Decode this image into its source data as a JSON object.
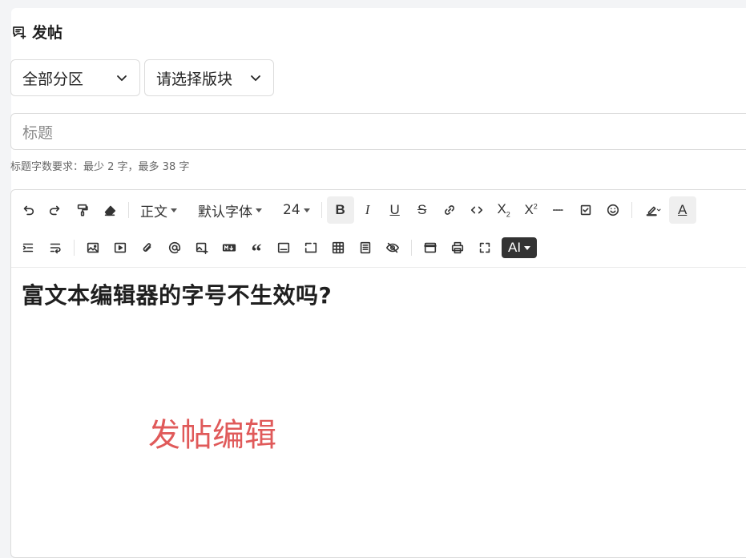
{
  "page": {
    "title": "发帖"
  },
  "selectors": {
    "category": "全部分区",
    "board": "请选择版块"
  },
  "title_field": {
    "placeholder": "标题",
    "hint": "标题字数要求：最少 2 字，最多 38 字"
  },
  "toolbar": {
    "paragraph": "正文",
    "font": "默认字体",
    "size": "24",
    "ai": "AI"
  },
  "editor": {
    "heading": "富文本编辑器的字号不生效吗?"
  },
  "annotation": "发帖编辑",
  "colors": {
    "annotation": "#e05a5a",
    "ai_button_bg": "#333333"
  },
  "icons": [
    "compose-icon",
    "chevron-down-icon",
    "undo-icon",
    "redo-icon",
    "format-painter-icon",
    "eraser-icon",
    "bold-icon",
    "italic-icon",
    "underline-icon",
    "strikethrough-icon",
    "link-icon",
    "code-icon",
    "subscript-icon",
    "superscript-icon",
    "horizontal-rule-icon",
    "checkbox-icon",
    "emoji-icon",
    "highlight-icon",
    "font-color-icon",
    "indent-icon",
    "wrap-icon",
    "image-icon",
    "video-icon",
    "attachment-icon",
    "mention-icon",
    "image-edit-icon",
    "markdown-icon",
    "quote-icon",
    "panel-icon",
    "snippet-icon",
    "table-icon",
    "document-icon",
    "hide-icon",
    "template-icon",
    "print-icon",
    "fullscreen-icon"
  ]
}
